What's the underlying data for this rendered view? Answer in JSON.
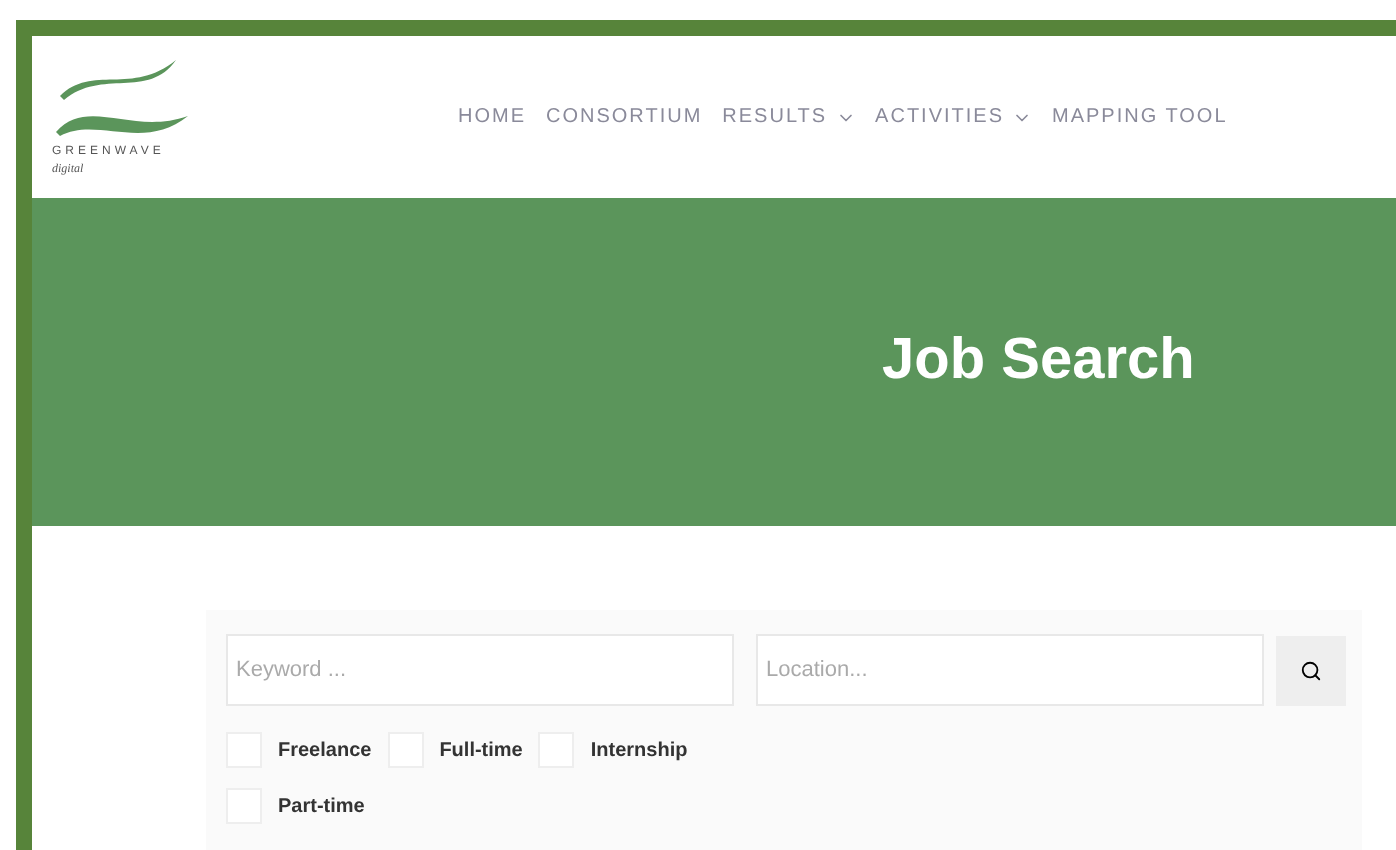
{
  "logo": {
    "name": "GREENWAVE",
    "tagline": "digital"
  },
  "nav": [
    {
      "label": "HOME",
      "dropdown": false
    },
    {
      "label": "CONSORTIUM",
      "dropdown": false
    },
    {
      "label": "RESULTS",
      "dropdown": true
    },
    {
      "label": "ACTIVITIES",
      "dropdown": true
    },
    {
      "label": "MAPPING TOOL",
      "dropdown": false
    }
  ],
  "banner": {
    "title": "Job Search"
  },
  "search": {
    "keyword_placeholder": "Keyword ...",
    "location_placeholder": "Location..."
  },
  "job_types": [
    {
      "label": "Freelance",
      "checked": false
    },
    {
      "label": "Full-time",
      "checked": false
    },
    {
      "label": "Internship",
      "checked": false
    },
    {
      "label": "Part-time",
      "checked": false
    }
  ]
}
